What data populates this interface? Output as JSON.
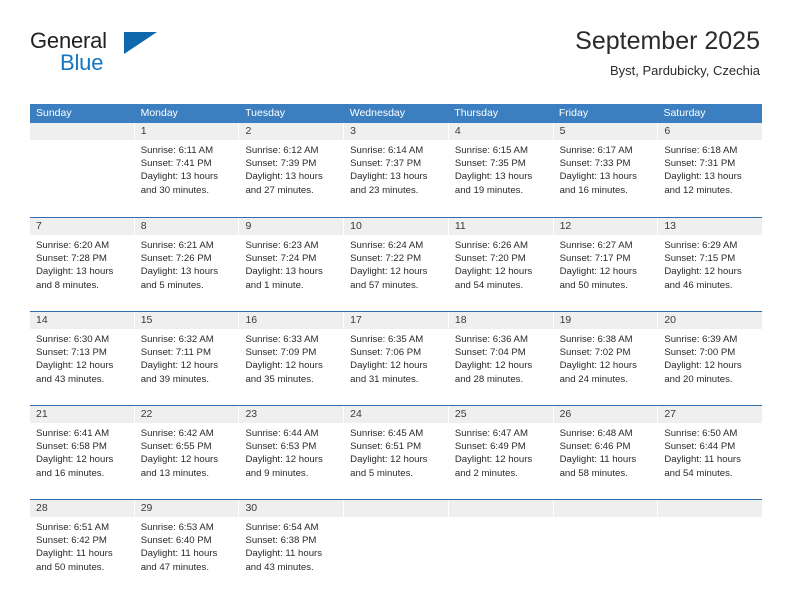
{
  "brand": {
    "name_part1": "General",
    "name_part2": "Blue"
  },
  "header": {
    "title": "September 2025",
    "location": "Byst, Pardubicky, Czechia"
  },
  "colors": {
    "header_blue": "#3c7fc1",
    "row_divider_blue": "#2f6fad",
    "day_band_gray": "#efefef",
    "logo_blue": "#1577c4"
  },
  "weekdays": [
    "Sunday",
    "Monday",
    "Tuesday",
    "Wednesday",
    "Thursday",
    "Friday",
    "Saturday"
  ],
  "weeks": [
    [
      {
        "day": "",
        "lines": []
      },
      {
        "day": "1",
        "lines": [
          "Sunrise: 6:11 AM",
          "Sunset: 7:41 PM",
          "Daylight: 13 hours",
          "and 30 minutes."
        ]
      },
      {
        "day": "2",
        "lines": [
          "Sunrise: 6:12 AM",
          "Sunset: 7:39 PM",
          "Daylight: 13 hours",
          "and 27 minutes."
        ]
      },
      {
        "day": "3",
        "lines": [
          "Sunrise: 6:14 AM",
          "Sunset: 7:37 PM",
          "Daylight: 13 hours",
          "and 23 minutes."
        ]
      },
      {
        "day": "4",
        "lines": [
          "Sunrise: 6:15 AM",
          "Sunset: 7:35 PM",
          "Daylight: 13 hours",
          "and 19 minutes."
        ]
      },
      {
        "day": "5",
        "lines": [
          "Sunrise: 6:17 AM",
          "Sunset: 7:33 PM",
          "Daylight: 13 hours",
          "and 16 minutes."
        ]
      },
      {
        "day": "6",
        "lines": [
          "Sunrise: 6:18 AM",
          "Sunset: 7:31 PM",
          "Daylight: 13 hours",
          "and 12 minutes."
        ]
      }
    ],
    [
      {
        "day": "7",
        "lines": [
          "Sunrise: 6:20 AM",
          "Sunset: 7:28 PM",
          "Daylight: 13 hours",
          "and 8 minutes."
        ]
      },
      {
        "day": "8",
        "lines": [
          "Sunrise: 6:21 AM",
          "Sunset: 7:26 PM",
          "Daylight: 13 hours",
          "and 5 minutes."
        ]
      },
      {
        "day": "9",
        "lines": [
          "Sunrise: 6:23 AM",
          "Sunset: 7:24 PM",
          "Daylight: 13 hours",
          "and 1 minute."
        ]
      },
      {
        "day": "10",
        "lines": [
          "Sunrise: 6:24 AM",
          "Sunset: 7:22 PM",
          "Daylight: 12 hours",
          "and 57 minutes."
        ]
      },
      {
        "day": "11",
        "lines": [
          "Sunrise: 6:26 AM",
          "Sunset: 7:20 PM",
          "Daylight: 12 hours",
          "and 54 minutes."
        ]
      },
      {
        "day": "12",
        "lines": [
          "Sunrise: 6:27 AM",
          "Sunset: 7:17 PM",
          "Daylight: 12 hours",
          "and 50 minutes."
        ]
      },
      {
        "day": "13",
        "lines": [
          "Sunrise: 6:29 AM",
          "Sunset: 7:15 PM",
          "Daylight: 12 hours",
          "and 46 minutes."
        ]
      }
    ],
    [
      {
        "day": "14",
        "lines": [
          "Sunrise: 6:30 AM",
          "Sunset: 7:13 PM",
          "Daylight: 12 hours",
          "and 43 minutes."
        ]
      },
      {
        "day": "15",
        "lines": [
          "Sunrise: 6:32 AM",
          "Sunset: 7:11 PM",
          "Daylight: 12 hours",
          "and 39 minutes."
        ]
      },
      {
        "day": "16",
        "lines": [
          "Sunrise: 6:33 AM",
          "Sunset: 7:09 PM",
          "Daylight: 12 hours",
          "and 35 minutes."
        ]
      },
      {
        "day": "17",
        "lines": [
          "Sunrise: 6:35 AM",
          "Sunset: 7:06 PM",
          "Daylight: 12 hours",
          "and 31 minutes."
        ]
      },
      {
        "day": "18",
        "lines": [
          "Sunrise: 6:36 AM",
          "Sunset: 7:04 PM",
          "Daylight: 12 hours",
          "and 28 minutes."
        ]
      },
      {
        "day": "19",
        "lines": [
          "Sunrise: 6:38 AM",
          "Sunset: 7:02 PM",
          "Daylight: 12 hours",
          "and 24 minutes."
        ]
      },
      {
        "day": "20",
        "lines": [
          "Sunrise: 6:39 AM",
          "Sunset: 7:00 PM",
          "Daylight: 12 hours",
          "and 20 minutes."
        ]
      }
    ],
    [
      {
        "day": "21",
        "lines": [
          "Sunrise: 6:41 AM",
          "Sunset: 6:58 PM",
          "Daylight: 12 hours",
          "and 16 minutes."
        ]
      },
      {
        "day": "22",
        "lines": [
          "Sunrise: 6:42 AM",
          "Sunset: 6:55 PM",
          "Daylight: 12 hours",
          "and 13 minutes."
        ]
      },
      {
        "day": "23",
        "lines": [
          "Sunrise: 6:44 AM",
          "Sunset: 6:53 PM",
          "Daylight: 12 hours",
          "and 9 minutes."
        ]
      },
      {
        "day": "24",
        "lines": [
          "Sunrise: 6:45 AM",
          "Sunset: 6:51 PM",
          "Daylight: 12 hours",
          "and 5 minutes."
        ]
      },
      {
        "day": "25",
        "lines": [
          "Sunrise: 6:47 AM",
          "Sunset: 6:49 PM",
          "Daylight: 12 hours",
          "and 2 minutes."
        ]
      },
      {
        "day": "26",
        "lines": [
          "Sunrise: 6:48 AM",
          "Sunset: 6:46 PM",
          "Daylight: 11 hours",
          "and 58 minutes."
        ]
      },
      {
        "day": "27",
        "lines": [
          "Sunrise: 6:50 AM",
          "Sunset: 6:44 PM",
          "Daylight: 11 hours",
          "and 54 minutes."
        ]
      }
    ],
    [
      {
        "day": "28",
        "lines": [
          "Sunrise: 6:51 AM",
          "Sunset: 6:42 PM",
          "Daylight: 11 hours",
          "and 50 minutes."
        ]
      },
      {
        "day": "29",
        "lines": [
          "Sunrise: 6:53 AM",
          "Sunset: 6:40 PM",
          "Daylight: 11 hours",
          "and 47 minutes."
        ]
      },
      {
        "day": "30",
        "lines": [
          "Sunrise: 6:54 AM",
          "Sunset: 6:38 PM",
          "Daylight: 11 hours",
          "and 43 minutes."
        ]
      },
      {
        "day": "",
        "lines": []
      },
      {
        "day": "",
        "lines": []
      },
      {
        "day": "",
        "lines": []
      },
      {
        "day": "",
        "lines": []
      }
    ]
  ]
}
